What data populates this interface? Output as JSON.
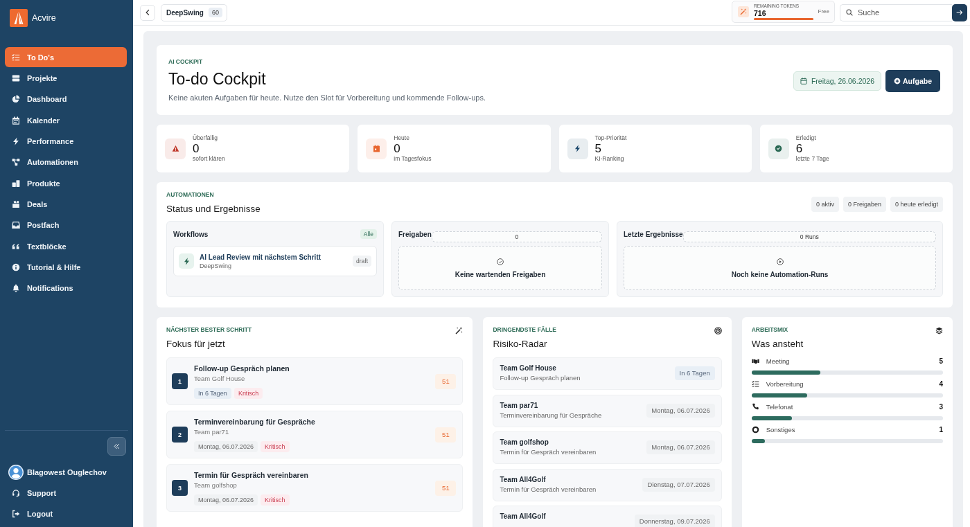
{
  "sidebar": {
    "brand": "Acvire",
    "items": [
      {
        "label": "To Do's",
        "selected": true
      },
      {
        "label": "Projekte",
        "selected": false
      },
      {
        "label": "Dashboard",
        "selected": false
      },
      {
        "label": "Kalender",
        "selected": false
      },
      {
        "label": "Performance",
        "selected": false
      },
      {
        "label": "Automationen",
        "selected": false
      },
      {
        "label": "Produkte",
        "selected": false
      },
      {
        "label": "Deals",
        "selected": false
      },
      {
        "label": "Postfach",
        "selected": false
      },
      {
        "label": "Textblöcke",
        "selected": false
      },
      {
        "label": "Tutorial & Hilfe",
        "selected": false
      },
      {
        "label": "Notifications",
        "selected": false
      }
    ],
    "user": {
      "name": "Blagowest Ouglechov"
    },
    "footer_items": [
      {
        "label": "Support"
      },
      {
        "label": "Logout"
      }
    ]
  },
  "topbar": {
    "project": {
      "name": "DeepSwing",
      "count": "60"
    },
    "tokens": {
      "label": "REMAINING TOKENS",
      "value": "716",
      "level": 1,
      "plan": "Free"
    },
    "search": {
      "placeholder": "Suche"
    }
  },
  "header": {
    "eyebrow": "AI COCKPIT",
    "title": "To-do Cockpit",
    "subtitle": "Keine akuten Aufgaben für heute. Nutze den Slot für Vorbereitung und kommende Follow-ups.",
    "date": "Freitag, 26.06.2026",
    "action": "Aufgabe"
  },
  "stats": [
    {
      "label": "Überfällig",
      "value": "0",
      "note": "sofort klären",
      "color": "#c0392b"
    },
    {
      "label": "Heute",
      "value": "0",
      "note": "im Tagesfokus",
      "color": "#e8662f"
    },
    {
      "label": "Top-Priorität",
      "value": "5",
      "note": "KI-Ranking",
      "color": "#1f4a6e"
    },
    {
      "label": "Erledigt",
      "value": "6",
      "note": "letzte 7 Tage",
      "color": "#2c6a55"
    }
  ],
  "automations": {
    "eyebrow": "AUTOMATIONEN",
    "title": "Status und Ergebnisse",
    "chips": [
      "0 aktiv",
      "0 Freigaben",
      "0 heute erledigt"
    ],
    "panels": [
      {
        "kind": "list",
        "title": "Workflows",
        "badge": "Alle",
        "items": [
          {
            "title": "AI Lead Review mit nächstem Schritt",
            "subtitle": "DeepSwing",
            "status": "draft"
          }
        ]
      },
      {
        "kind": "empty",
        "title": "Freigaben",
        "badge": "0",
        "message": "Keine wartenden Freigaben"
      },
      {
        "kind": "empty",
        "title": "Letzte Ergebnisse",
        "badge": "0 Runs",
        "message": "Noch keine Automation-Runs"
      }
    ]
  },
  "focus": {
    "eyebrow": "NÄCHSTER BESTER SCHRITT",
    "title": "Fokus für jetzt",
    "items": [
      {
        "rank": "1",
        "title": "Follow-up Gespräch planen",
        "team": "Team Golf House",
        "tags": [
          {
            "kind": "due",
            "label": "In 6 Tagen"
          },
          {
            "kind": "priority",
            "label": "Kritisch"
          }
        ],
        "score": "51"
      },
      {
        "rank": "2",
        "title": "Terminvereinbarung für Gespräche",
        "team": "Team par71",
        "tags": [
          {
            "kind": "date",
            "label": "Montag, 06.07.2026"
          },
          {
            "kind": "priority",
            "label": "Kritisch"
          }
        ],
        "score": "51"
      },
      {
        "rank": "3",
        "title": "Termin für Gespräch vereinbaren",
        "team": "Team golfshop",
        "tags": [
          {
            "kind": "date",
            "label": "Montag, 06.07.2026"
          },
          {
            "kind": "priority",
            "label": "Kritisch"
          }
        ],
        "score": "51"
      }
    ]
  },
  "radar": {
    "eyebrow": "DRINGENDSTE FÄLLE",
    "title": "Risiko-Radar",
    "items": [
      {
        "team": "Team Golf House",
        "task": "Follow-up Gespräch planen",
        "due": {
          "kind": "due",
          "label": "In 6 Tagen"
        }
      },
      {
        "team": "Team par71",
        "task": "Terminvereinbarung für Gespräche",
        "due": {
          "kind": "date",
          "label": "Montag, 06.07.2026"
        }
      },
      {
        "team": "Team golfshop",
        "task": "Termin für Gespräch vereinbaren",
        "due": {
          "kind": "date",
          "label": "Montag, 06.07.2026"
        }
      },
      {
        "team": "Team All4Golf",
        "task": "Termin für Gespräch vereinbaren",
        "due": {
          "kind": "date",
          "label": "Dienstag, 07.07.2026"
        }
      },
      {
        "team": "Team All4Golf",
        "due": {
          "kind": "date",
          "label": "Donnerstag, 09.07.2026"
        }
      }
    ]
  },
  "mix": {
    "eyebrow": "ARBEITSMIX",
    "title": "Was ansteht",
    "rows": [
      {
        "label": "Meeting",
        "count": "5",
        "level": 0.36
      },
      {
        "label": "Vorbereitung",
        "count": "4",
        "level": 0.29
      },
      {
        "label": "Telefonat",
        "count": "3",
        "level": 0.21
      },
      {
        "label": "Sonstiges",
        "count": "1",
        "level": 0.07
      }
    ]
  }
}
